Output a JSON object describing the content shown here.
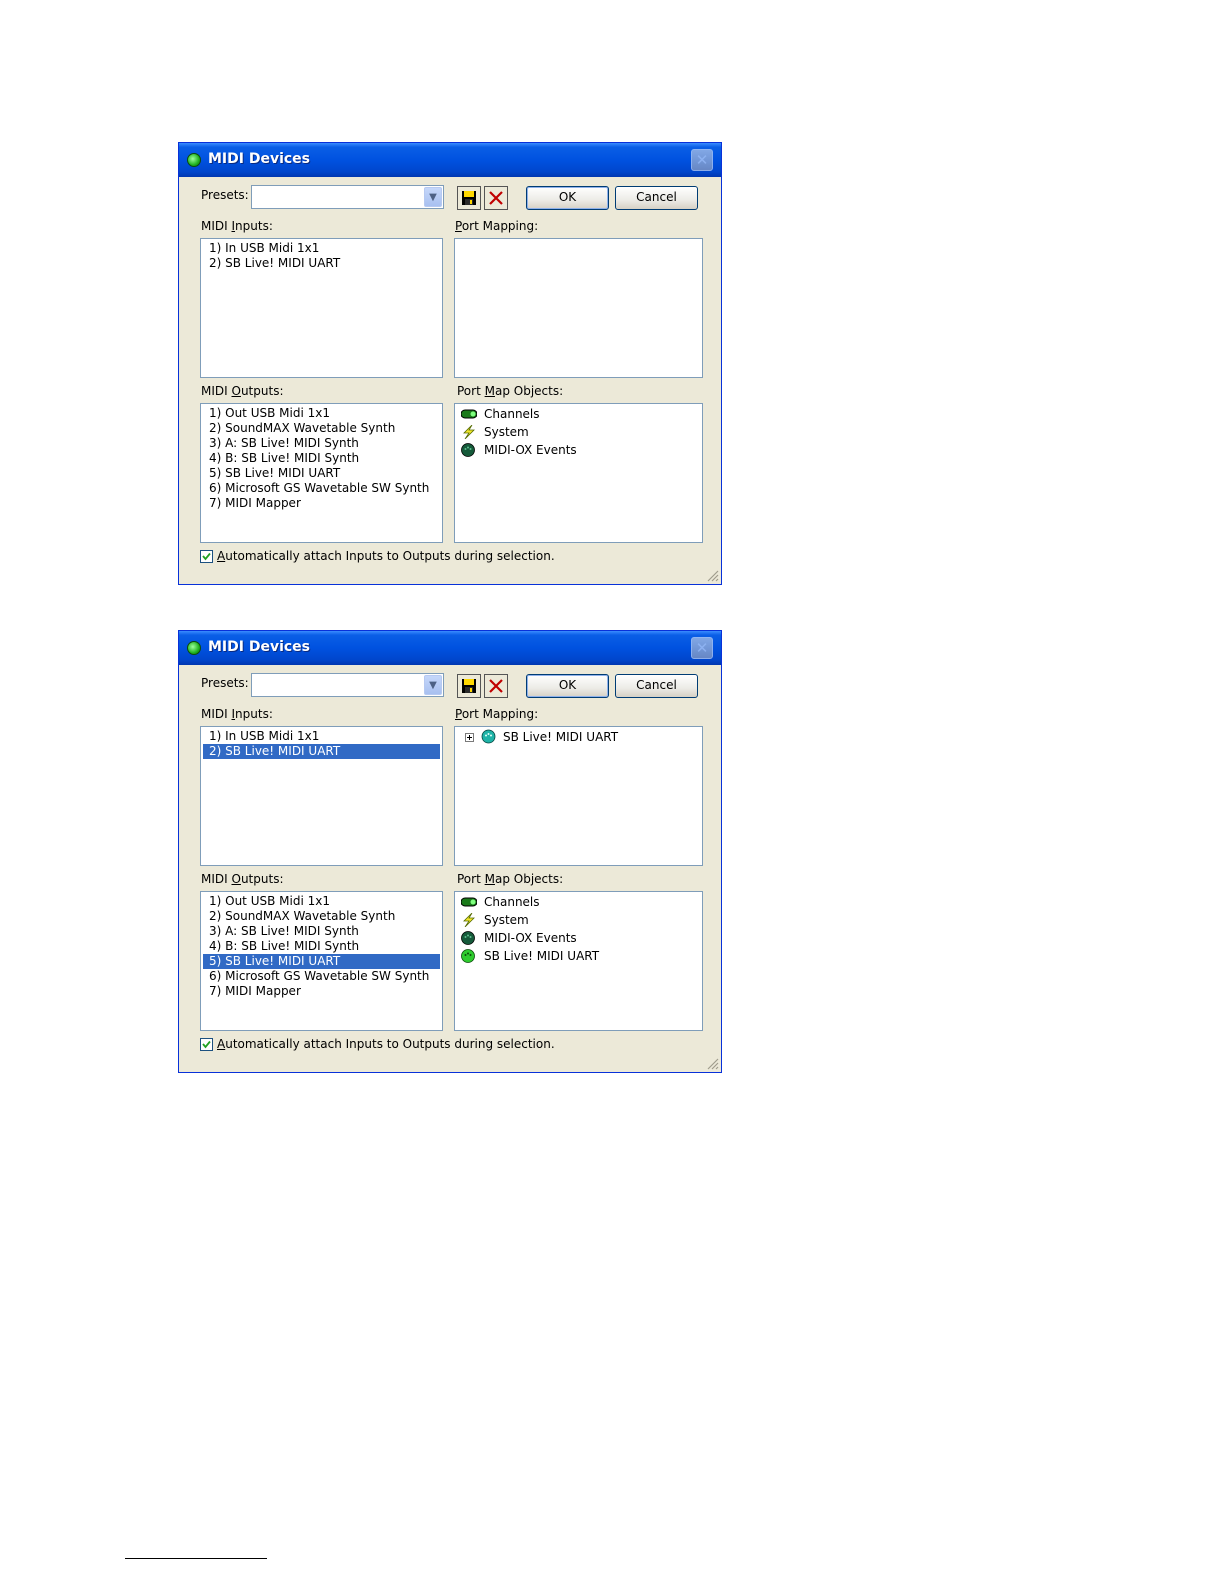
{
  "dialogs": [
    {
      "title": "MIDI Devices",
      "close": "✕",
      "presets_label": "Presets:",
      "presets_value": "",
      "ok": "OK",
      "cancel": "Cancel",
      "inputs_label": "MIDI Inputs:",
      "mapping_label": "Port Mapping:",
      "outputs_label": "MIDI Outputs:",
      "objects_label": "Port Map Objects:",
      "inputs": [
        "1)  In USB Midi 1x1",
        "2)  SB Live! MIDI UART"
      ],
      "outputs": [
        "1)  Out USB Midi 1x1",
        "2)  SoundMAX Wavetable Synth",
        "3)  A: SB Live! MIDI Synth",
        "4)  B: SB Live! MIDI Synth",
        "5)  SB Live! MIDI UART",
        "6)  Microsoft GS Wavetable SW Synth",
        "7)  MIDI Mapper"
      ],
      "mapping": [],
      "objects": [
        {
          "label": "Channels",
          "icon": "channels-icon"
        },
        {
          "label": "System",
          "icon": "lightning-icon"
        },
        {
          "label": "MIDI-OX Events",
          "icon": "midi-port-icon"
        }
      ],
      "auto_attach_label": "Automatically attach Inputs to Outputs during selection.",
      "auto_attach_checked": true
    },
    {
      "title": "MIDI Devices",
      "close": "✕",
      "presets_label": "Presets:",
      "presets_value": "",
      "ok": "OK",
      "cancel": "Cancel",
      "inputs_label": "MIDI Inputs:",
      "mapping_label": "Port Mapping:",
      "outputs_label": "MIDI Outputs:",
      "objects_label": "Port Map Objects:",
      "inputs": [
        "1)  In USB Midi 1x1",
        "2)  SB Live! MIDI UART"
      ],
      "inputs_selected": 1,
      "outputs": [
        "1)  Out USB Midi 1x1",
        "2)  SoundMAX Wavetable Synth",
        "3)  A: SB Live! MIDI Synth",
        "4)  B: SB Live! MIDI Synth",
        "5)  SB Live! MIDI UART",
        "6)  Microsoft GS Wavetable SW Synth",
        "7)  MIDI Mapper"
      ],
      "outputs_selected": 4,
      "mapping": [
        "SB Live! MIDI UART"
      ],
      "objects": [
        {
          "label": "Channels",
          "icon": "channels-icon"
        },
        {
          "label": "System",
          "icon": "lightning-icon"
        },
        {
          "label": "MIDI-OX Events",
          "icon": "midi-port-icon"
        },
        {
          "label": "SB Live! MIDI UART",
          "icon": "midi-port-green-icon"
        }
      ],
      "auto_attach_label": "Automatically attach Inputs to Outputs during selection.",
      "auto_attach_checked": true
    }
  ],
  "colors": {
    "selection": "#316ac5",
    "titlebar": "#0052e0",
    "dialog_bg": "#ece9d8"
  }
}
